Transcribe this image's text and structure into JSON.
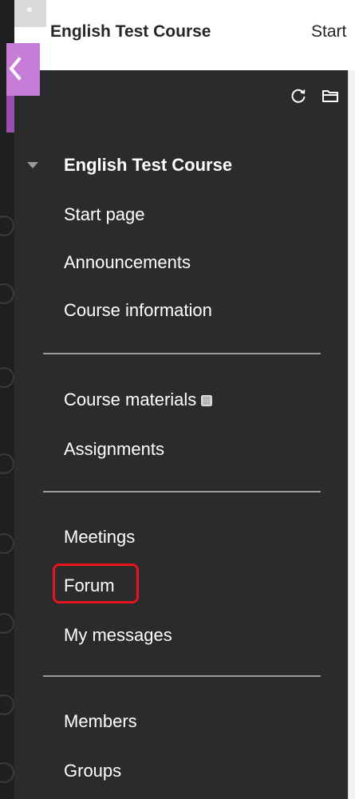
{
  "header": {
    "course_title": "English Test Course",
    "nav_tab_partial": "Start"
  },
  "panel": {
    "tools": [
      {
        "icon": "refresh-icon"
      },
      {
        "icon": "folder-icon"
      }
    ],
    "course_name": "English Test Course",
    "groups": [
      {
        "items": [
          {
            "label": "Start page"
          },
          {
            "label": "Announcements"
          },
          {
            "label": "Course information"
          }
        ]
      },
      {
        "items": [
          {
            "label": "Course materials",
            "badge_icon": "hidden-item-icon"
          },
          {
            "label": "Assignments"
          }
        ]
      },
      {
        "items": [
          {
            "label": "Meetings"
          },
          {
            "label": "Forum",
            "highlighted": true
          },
          {
            "label": "My messages"
          }
        ]
      },
      {
        "items": [
          {
            "label": "Members"
          },
          {
            "label": "Groups"
          }
        ]
      }
    ]
  },
  "colors": {
    "panel_bg": "#2b2b2b",
    "close_tab": "#c77dd7",
    "highlight": "#e8141c",
    "separator": "#9a9a9a"
  }
}
